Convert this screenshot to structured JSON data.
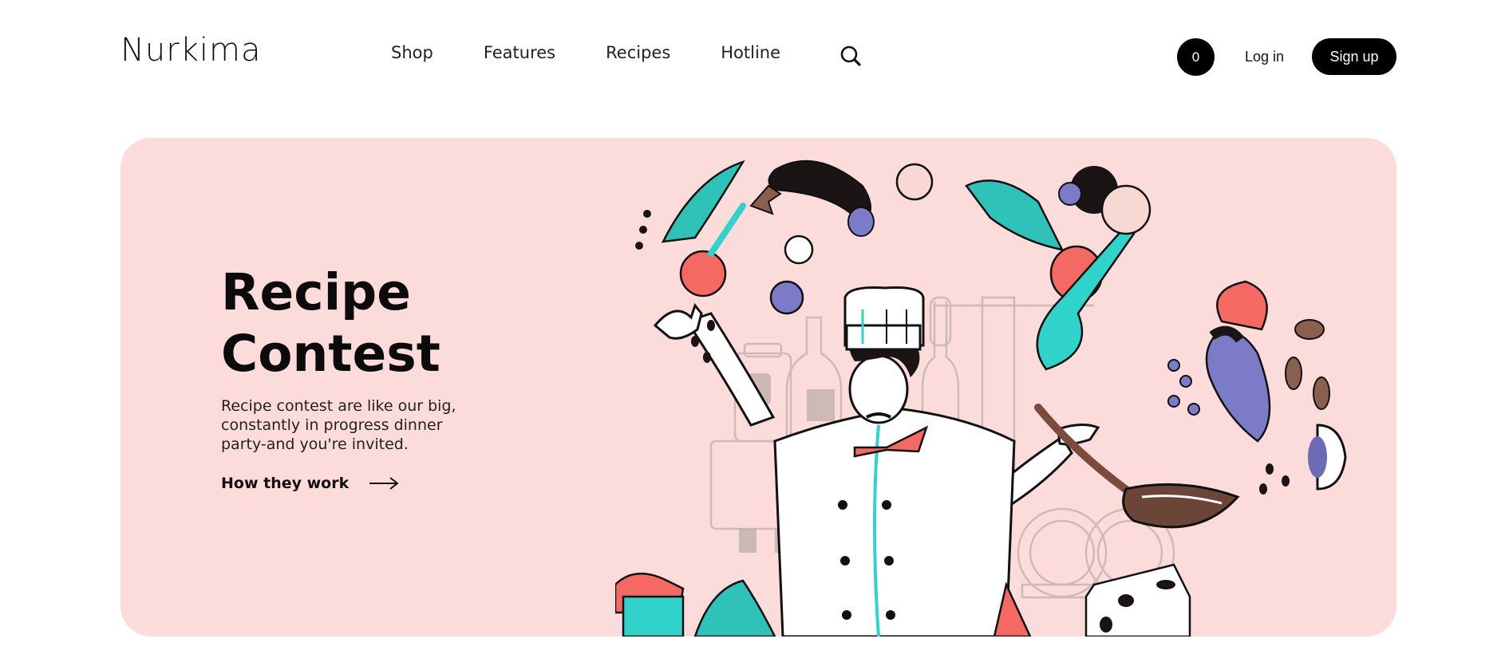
{
  "header": {
    "logo": "Nurkima",
    "nav": [
      "Shop",
      "Features",
      "Recipes",
      "Hotline"
    ],
    "search_icon": "search-icon",
    "cart_count": "0",
    "login_label": "Log in",
    "signup_label": "Sign up"
  },
  "hero": {
    "title_line1": "Recipe",
    "title_line2": "Contest",
    "description": "Recipe contest are like our big, constantly in progress dinner party-and you're invited.",
    "link_label": "How they work",
    "link_icon": "arrow-right-icon",
    "illustration": "chef-illustration",
    "background_color": "#fcdcdb"
  },
  "colors": {
    "accent": "#000000",
    "coral": "#f46a63",
    "teal": "#2fd3c9",
    "violet": "#7b7bc8"
  }
}
